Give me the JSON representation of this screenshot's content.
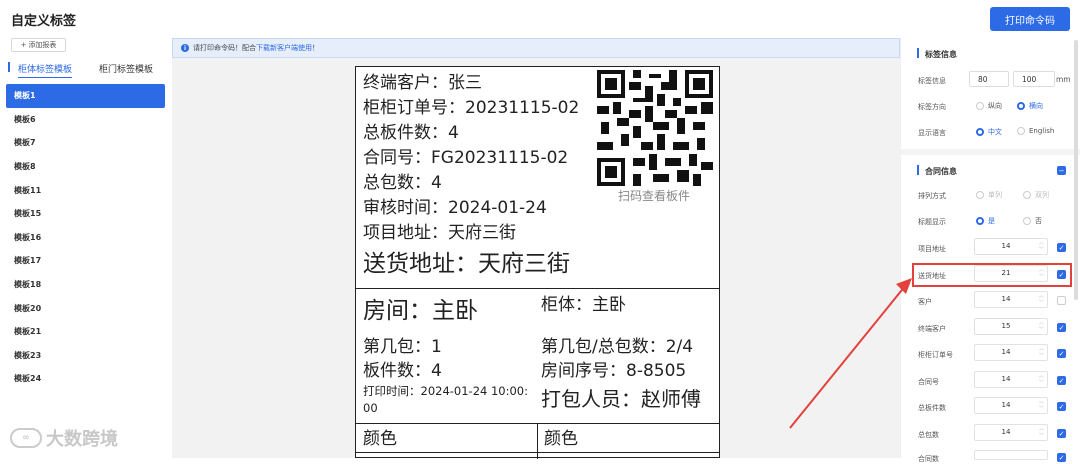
{
  "header": {
    "title": "自定义标签",
    "print_button": "打印命令码"
  },
  "sidebar": {
    "add_button": "添加报表",
    "tabs": [
      "柜体标签模板",
      "柜门标签模板"
    ],
    "templates": [
      "模板1",
      "模板6",
      "模板7",
      "模板8",
      "模板11",
      "模板15",
      "模板16",
      "模板17",
      "模板18",
      "模板20",
      "模板21",
      "模板23",
      "模板24"
    ],
    "selected_index": 0
  },
  "notice": {
    "text": "请打印命令码！配合",
    "link": "下载新客户端使用",
    "suffix": "！"
  },
  "label": {
    "lines_top": [
      "终端客户：张三",
      "柜柜订单号：20231115-02",
      "总板件数：4",
      "合同号：FG20231115-02",
      "总包数：4",
      "审核时间：2024-01-24",
      "项目地址：天府三街"
    ],
    "delivery": "送货地址：天府三街",
    "qr_caption": "扫码查看板件",
    "room": "房间：主卧",
    "cabinet": "柜体：主卧",
    "pack_no": "第几包：1",
    "pack_total": "第几包/总包数：2/4",
    "board_count": "板件数：4",
    "room_seq": "房间序号：8-8505",
    "print_time": "打印时间：2024-01-24 10:00:",
    "print_time_cont": "00",
    "packer": "打包人员：赵师傅",
    "color_left": "颜色",
    "color_right": "颜色"
  },
  "panel": {
    "label_info_title": "标签信息",
    "label_info_label": "标签信息",
    "width": "80",
    "height": "100",
    "unit": "mm",
    "direction_label": "标签方向",
    "direction_options": [
      "纵向",
      "横向"
    ],
    "direction_selected": "横向",
    "language_label": "显示语言",
    "language_options": [
      "中文",
      "English"
    ],
    "language_selected": "中文",
    "contract_title": "合同信息",
    "arrange_label": "排列方式",
    "arrange_options": [
      "单列",
      "双列"
    ],
    "title_label": "标题显示",
    "title_options": [
      "是",
      "否"
    ],
    "title_selected": "是",
    "fields": [
      {
        "name": "项目地址",
        "size": "14",
        "checked": true
      },
      {
        "name": "送货地址",
        "size": "21",
        "checked": true
      },
      {
        "name": "客户",
        "size": "14",
        "checked": false
      },
      {
        "name": "终端客户",
        "size": "15",
        "checked": true
      },
      {
        "name": "柜柜订单号",
        "size": "14",
        "checked": true
      },
      {
        "name": "合同号",
        "size": "14",
        "checked": true
      },
      {
        "name": "总板件数",
        "size": "14",
        "checked": true
      },
      {
        "name": "总包数",
        "size": "14",
        "checked": true
      },
      {
        "name": "合同数",
        "size": "",
        "checked": true
      }
    ]
  },
  "watermark": "大数跨境",
  "colors": {
    "accent": "#2c6ae6",
    "highlight": "#e3413b"
  }
}
